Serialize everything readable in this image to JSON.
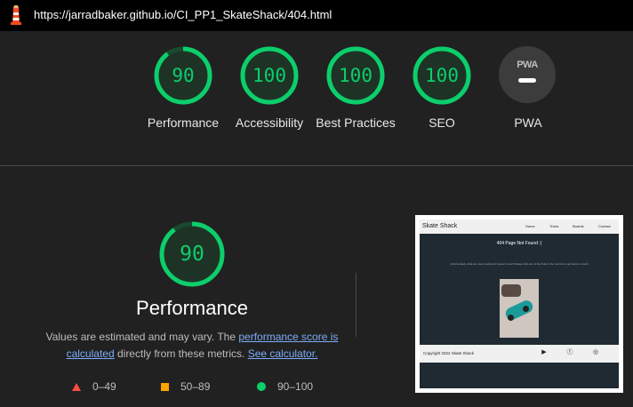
{
  "header": {
    "url": "https://jarradbaker.github.io/CI_PP1_SkateShack/404.html"
  },
  "categories": [
    {
      "label": "Performance",
      "score": 90
    },
    {
      "label": "Accessibility",
      "score": 100
    },
    {
      "label": "Best Practices",
      "score": 100
    },
    {
      "label": "SEO",
      "score": 100
    },
    {
      "label": "PWA",
      "badge": "PWA"
    }
  ],
  "detail": {
    "score": "90",
    "title": "Performance",
    "desc_prefix": "Values are estimated and may vary. The ",
    "desc_link1": "performance score is calculated",
    "desc_mid": " directly from these metrics. ",
    "desc_link2": "See calculator."
  },
  "legend": [
    {
      "range": "0–49",
      "color": "#ff4e42"
    },
    {
      "range": "50–89",
      "color": "#ffa400"
    },
    {
      "range": "90–100",
      "color": "#0cce6b"
    }
  ],
  "screenshot": {
    "brand": "Skate Shack",
    "nav": [
      "Home",
      "Tricks",
      "Boards",
      "Contact"
    ],
    "heading": "404 Page Not Found :(",
    "body": "Unfortunately what you were looking for doesn't exist! Please click any of the links in the nav bar to get back on track!",
    "footer": "Copyright 2022 Skate Shack",
    "social_icons": [
      "youtube-icon",
      "facebook-icon",
      "instagram-icon"
    ]
  },
  "colors": {
    "pass": "#0cce6b",
    "background": "#212121",
    "link": "#7cacf8"
  }
}
